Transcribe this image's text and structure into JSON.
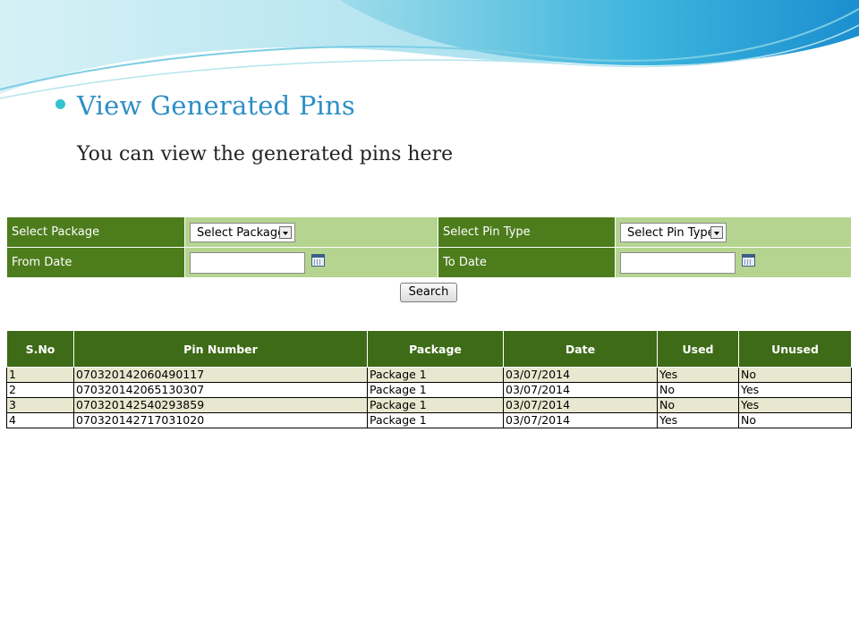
{
  "slide": {
    "heading": "View Generated Pins",
    "subtitle": "You can view the generated pins here"
  },
  "form": {
    "package_label": "Select Package",
    "package_selected": "Select Package",
    "pin_type_label": "Select Pin Type",
    "pin_type_selected": "Select Pin Type",
    "from_date_label": "From Date",
    "from_date_value": "",
    "to_date_label": "To Date",
    "to_date_value": "",
    "search_label": "Search"
  },
  "table": {
    "headers": [
      "S.No",
      "Pin Number",
      "Package",
      "Date",
      "Used",
      "Unused"
    ],
    "rows": [
      [
        "1",
        "070320142060490117",
        "Package 1",
        "03/07/2014",
        "Yes",
        "No"
      ],
      [
        "2",
        "070320142065130307",
        "Package 1",
        "03/07/2014",
        "No",
        "Yes"
      ],
      [
        "3",
        "070320142540293859",
        "Package 1",
        "03/07/2014",
        "No",
        "Yes"
      ],
      [
        "4",
        "070320142717031020",
        "Package 1",
        "03/07/2014",
        "Yes",
        "No"
      ]
    ]
  },
  "colors": {
    "label_green": "#4d7c1c",
    "field_green": "#b5d48f",
    "header_green": "#3e6b17",
    "row_alt": "#e8e8d0",
    "heading_blue": "#2e8fc6",
    "bullet": "#33c3cf"
  }
}
